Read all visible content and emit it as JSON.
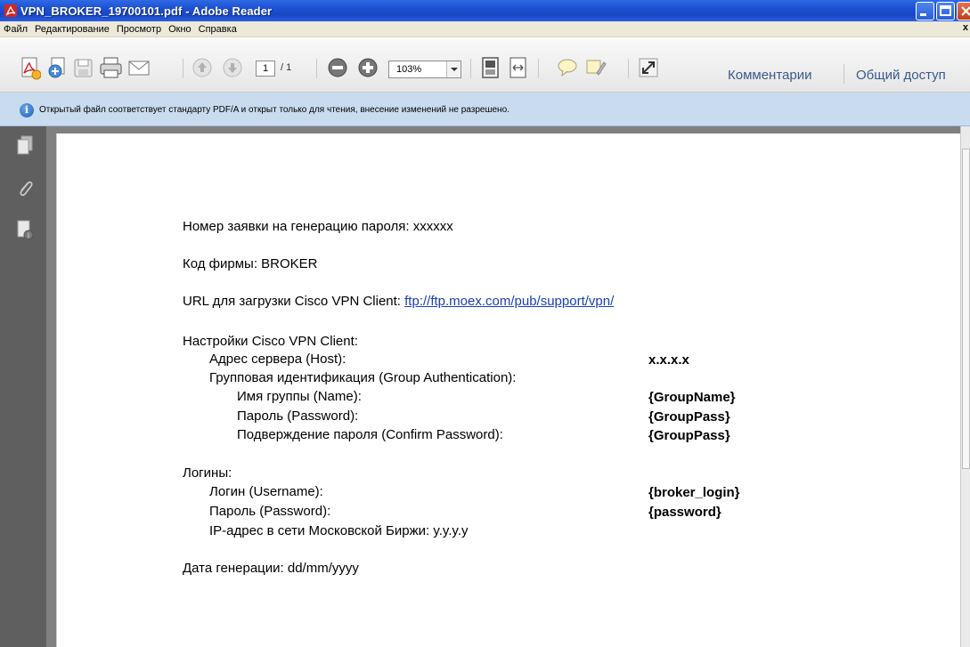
{
  "window": {
    "title": "VPN_BROKER_19700101.pdf - Adobe Reader"
  },
  "menu": {
    "items": [
      "Файл",
      "Редактирование",
      "Просмотр",
      "Окно",
      "Справка"
    ],
    "close_glyph": "x"
  },
  "toolbar": {
    "page_current": "1",
    "page_total": "/ 1",
    "zoom": "103%",
    "comments_label": "Комментарии",
    "share_label": "Общий доступ"
  },
  "infobar": {
    "message": "Открытый файл соответствует стандарту PDF/A и открыт только для чтения, внесение изменений не разрешено."
  },
  "document": {
    "request_label": "Номер заявки на генерацию пароля: ",
    "request_value": "xxxxxx",
    "firm_label": "Код фирмы: ",
    "firm_value": "BROKER",
    "url_label": "URL для загрузки Cisco VPN Client: ",
    "url_value": "ftp://ftp.moex.com/pub/support/vpn/",
    "settings_title": "Настройки Cisco VPN Client:",
    "server_label": "Адрес сервера (Host):",
    "server_value": "x.x.x.x",
    "group_auth_label": "Групповая идентификация (Group Authentication):",
    "group_name_label": "Имя группы (Name):",
    "group_name_value": "{GroupName}",
    "group_pass_label": "Пароль (Password):",
    "group_pass_value": "{GroupPass}",
    "group_confirm_label": "Подверждение пароля (Confirm Password):",
    "group_confirm_value": "{GroupPass}",
    "logins_title": "Логины:",
    "login_label": "Логин (Username):",
    "login_value": "{broker_login}",
    "password_label": "Пароль (Password):",
    "password_value": "{password}",
    "ip_label": "IP-адрес в сети Московской Биржи: ",
    "ip_value": "y.y.y.y",
    "date_label": "Дата генерации: ",
    "date_value": "dd/mm/yyyy"
  },
  "colors": {
    "titlebar": "#1c4fd1",
    "infobar": "#c9dcef",
    "link": "#1a3fb5"
  }
}
